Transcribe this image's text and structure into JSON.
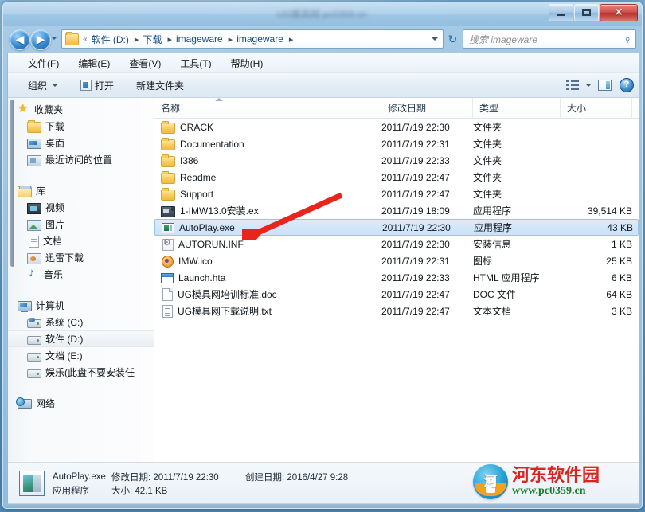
{
  "window": {
    "title_blurred": "UG模具网 pc0359.cn",
    "minimize_label": "最小化",
    "maximize_label": "最大化",
    "close_label": "✕"
  },
  "addressbar": {
    "back_label": "◀",
    "forward_label": "▶",
    "history_label": "▾",
    "root_chevron": "«",
    "crumbs": [
      "软件 (D:)",
      "下载",
      "imageware",
      "imageware"
    ],
    "separator": "▸",
    "dropdown_label": "▾",
    "refresh_label": "↻"
  },
  "search": {
    "placeholder": "搜索 imageware",
    "icon": "search-icon",
    "glyph": "⌕"
  },
  "menubar": {
    "items": [
      "文件(F)",
      "编辑(E)",
      "查看(V)",
      "工具(T)",
      "帮助(H)"
    ]
  },
  "toolbar": {
    "organize_label": "组织",
    "open_label": "打开",
    "new_folder_label": "新建文件夹",
    "view_icon": "list-view-icon",
    "view_caret": "▾",
    "preview_pane_icon": "preview-pane-icon",
    "help_icon": "help-icon",
    "help_glyph": "?"
  },
  "navpane": {
    "groups": [
      {
        "header": {
          "label": "收藏夹",
          "icon": "star-icon"
        },
        "items": [
          {
            "label": "下载",
            "icon": "folder-icon"
          },
          {
            "label": "桌面",
            "icon": "desktop-icon"
          },
          {
            "label": "最近访问的位置",
            "icon": "recent-places-icon"
          }
        ]
      },
      {
        "header": {
          "label": "库",
          "icon": "library-icon"
        },
        "items": [
          {
            "label": "视频",
            "icon": "video-icon"
          },
          {
            "label": "图片",
            "icon": "pictures-icon"
          },
          {
            "label": "文档",
            "icon": "documents-icon"
          },
          {
            "label": "迅雷下载",
            "icon": "thunder-download-icon"
          },
          {
            "label": "音乐",
            "icon": "music-icon"
          }
        ]
      },
      {
        "header": {
          "label": "计算机",
          "icon": "computer-icon"
        },
        "items": [
          {
            "label": "系统 (C:)",
            "icon": "system-drive-icon",
            "selected": false
          },
          {
            "label": "软件 (D:)",
            "icon": "drive-icon",
            "selected": true
          },
          {
            "label": "文档 (E:)",
            "icon": "drive-icon",
            "selected": false
          },
          {
            "label": "娱乐(此盘不要安装任",
            "icon": "drive-icon",
            "selected": false
          }
        ]
      },
      {
        "header": {
          "label": "网络",
          "icon": "network-icon"
        },
        "items": []
      }
    ]
  },
  "filelist": {
    "columns": [
      {
        "label": "名称",
        "sorted": true,
        "sort_direction": "asc"
      },
      {
        "label": "修改日期",
        "sorted": false
      },
      {
        "label": "类型",
        "sorted": false
      },
      {
        "label": "大小",
        "sorted": false
      }
    ],
    "rows": [
      {
        "name": "CRACK",
        "date": "2011/7/19 22:30",
        "type": "文件夹",
        "size": "",
        "icon": "folder-icon",
        "selected": false
      },
      {
        "name": "Documentation",
        "date": "2011/7/19 22:31",
        "type": "文件夹",
        "size": "",
        "icon": "folder-icon",
        "selected": false
      },
      {
        "name": "I386",
        "date": "2011/7/19 22:33",
        "type": "文件夹",
        "size": "",
        "icon": "folder-icon",
        "selected": false
      },
      {
        "name": "Readme",
        "date": "2011/7/19 22:47",
        "type": "文件夹",
        "size": "",
        "icon": "folder-icon",
        "selected": false
      },
      {
        "name": "Support",
        "date": "2011/7/19 22:47",
        "type": "文件夹",
        "size": "",
        "icon": "folder-icon",
        "selected": false
      },
      {
        "name": "1-IMW13.0安装.ex",
        "date": "2011/7/19 18:09",
        "type": "应用程序",
        "size": "39,514 KB",
        "icon": "setup-exe-icon",
        "selected": false
      },
      {
        "name": "AutoPlay.exe",
        "date": "2011/7/19 22:30",
        "type": "应用程序",
        "size": "43 KB",
        "icon": "exe-icon",
        "selected": true
      },
      {
        "name": "AUTORUN.INF",
        "date": "2011/7/19 22:30",
        "type": "安装信息",
        "size": "1 KB",
        "icon": "inf-icon",
        "selected": false
      },
      {
        "name": "IMW.ico",
        "date": "2011/7/19 22:31",
        "type": "图标",
        "size": "25 KB",
        "icon": "ico-file-icon",
        "selected": false
      },
      {
        "name": "Launch.hta",
        "date": "2011/7/19 22:33",
        "type": "HTML 应用程序",
        "size": "6 KB",
        "icon": "hta-icon",
        "selected": false
      },
      {
        "name": "UG模具网培训标准.doc",
        "date": "2011/7/19 22:47",
        "type": "DOC 文件",
        "size": "64 KB",
        "icon": "doc-icon",
        "selected": false
      },
      {
        "name": "UG模具网下载说明.txt",
        "date": "2011/7/19 22:47",
        "type": "文本文档",
        "size": "3 KB",
        "icon": "txt-icon",
        "selected": false
      }
    ]
  },
  "annotation": {
    "arrow_color": "#e8251d",
    "arrow_target": "AutoPlay.exe"
  },
  "details": {
    "file_name": "AutoPlay.exe",
    "modified_label": "修改日期:",
    "modified_value": "2011/7/19 22:30",
    "created_label": "创建日期:",
    "created_value": "2016/4/27 9:28",
    "type_value": "应用程序",
    "size_label": "大小:",
    "size_value": "42.1 KB"
  },
  "watermark": {
    "badge_text": "河",
    "site_name": "河东软件园",
    "site_url": "www.pc0359.cn"
  },
  "colors": {
    "selection_blue": "#cbe2f8",
    "crumb_link": "#13498b",
    "arrow_red": "#e8251d",
    "watermark_red": "#d9241f",
    "watermark_green": "#1b7a2e"
  }
}
